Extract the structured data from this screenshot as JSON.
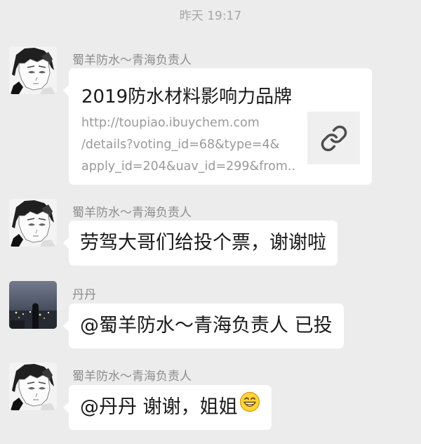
{
  "timestamp": "昨天 19:17",
  "messages": [
    {
      "sender": "蜀羊防水～青海负责人",
      "type": "link",
      "link": {
        "title": "2019防水材料影响力品牌",
        "url_line1": "http://toupiao.ibuychem.com",
        "url_line2": "/details?voting_id=68&type=4&",
        "url_line3": "apply_id=204&uav_id=299&from...",
        "thumb_icon": "link-icon"
      }
    },
    {
      "sender": "蜀羊防水～青海负责人",
      "type": "text",
      "text": "劳驾大哥们给投个票，谢谢啦"
    },
    {
      "sender": "丹丹",
      "type": "text",
      "text": "@蜀羊防水～青海负责人  已投"
    },
    {
      "sender": "蜀羊防水～青海负责人",
      "type": "text",
      "text": "@丹丹  谢谢，姐姐",
      "emoji": "grinning-face-emoji"
    }
  ],
  "colors": {
    "background": "#ececec",
    "bubble": "#ffffff",
    "sender_name": "#8d8d8d",
    "url_text": "#9a9a9a",
    "emoji_fill": "#fcd535"
  }
}
